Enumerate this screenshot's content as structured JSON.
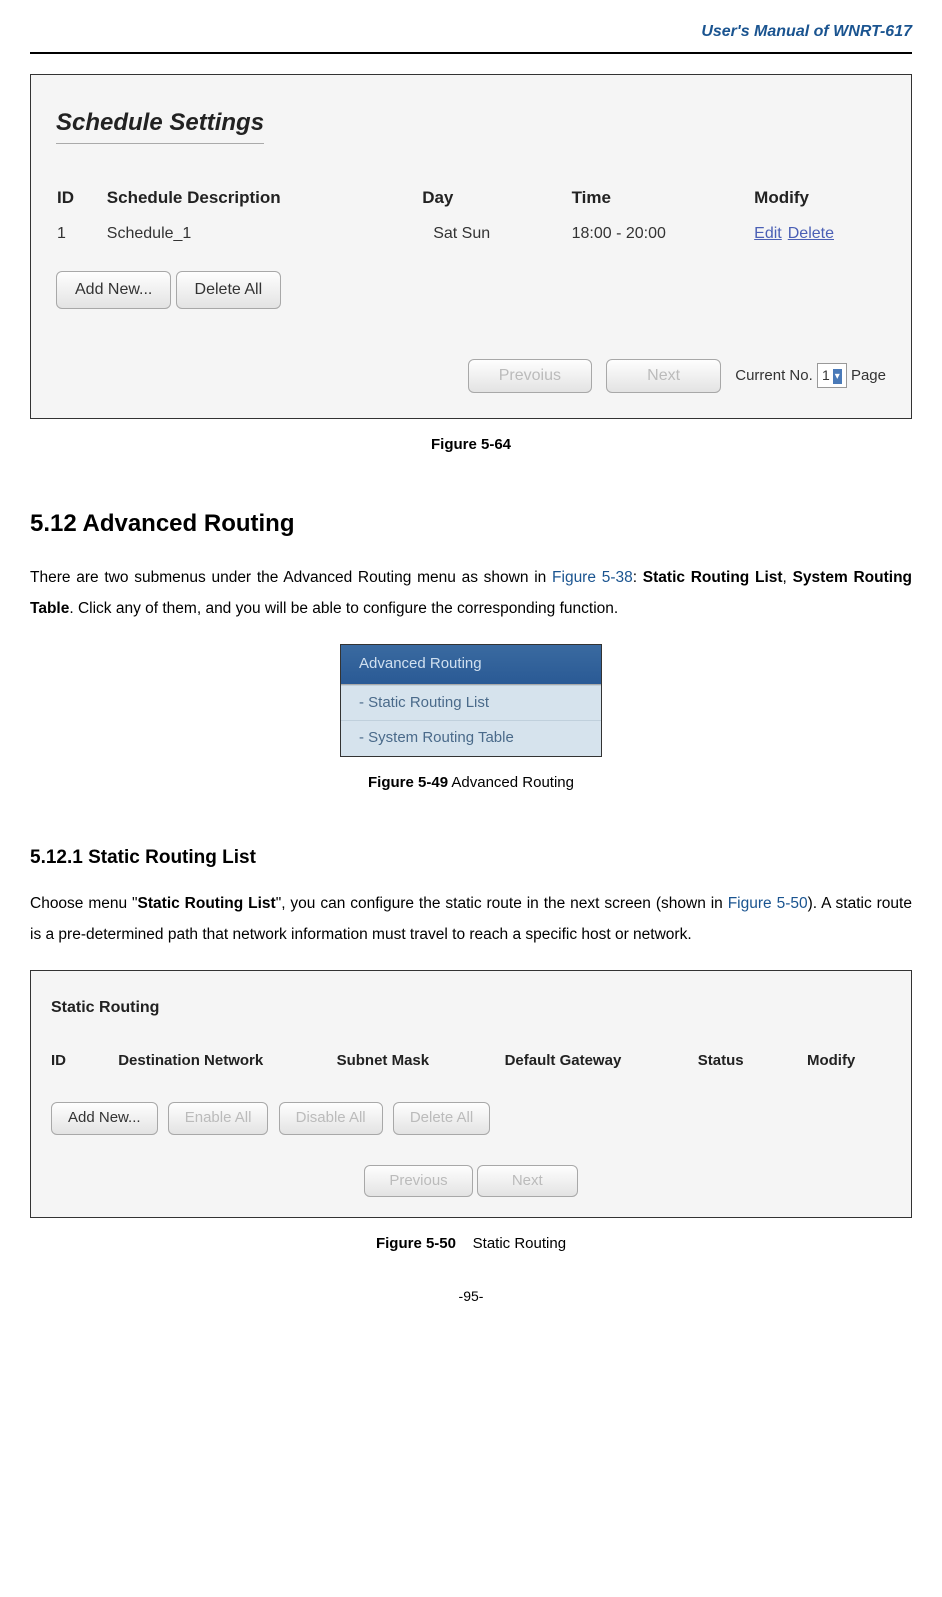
{
  "header": {
    "title": "User's Manual of WNRT-617"
  },
  "schedule": {
    "title": "Schedule Settings",
    "columns": {
      "id": "ID",
      "desc": "Schedule Description",
      "day": "Day",
      "time": "Time",
      "modify": "Modify"
    },
    "row": {
      "id": "1",
      "desc": "Schedule_1",
      "day": "Sat  Sun",
      "time": "18:00 - 20:00",
      "edit": "Edit",
      "delete": "Delete"
    },
    "buttons": {
      "add": "Add New...",
      "delete_all": "Delete All"
    },
    "pager": {
      "prev": "Prevoius",
      "next": "Next",
      "current_label": "Current No.",
      "current_value": "1",
      "page_suffix": "Page"
    }
  },
  "caption1": "Figure 5-64",
  "section512": {
    "heading": "5.12  Advanced Routing",
    "para_pre": "There are two submenus under the Advanced Routing menu as shown in ",
    "para_link": "Figure 5-38",
    "para_mid": ": ",
    "para_b1": "Static Routing List",
    "para_sep": ", ",
    "para_b2": "System Routing Table",
    "para_post": ". Click any of them, and you will be able to configure the corresponding function."
  },
  "menu": {
    "header": "Advanced Routing",
    "item1": "-  Static Routing List",
    "item2": "-  System Routing Table"
  },
  "caption2": {
    "bold": "Figure 5-49",
    "rest": " Advanced Routing"
  },
  "section5121": {
    "heading": "5.12.1  Static Routing List",
    "p1": "Choose menu \"",
    "p1b": "Static Routing List",
    "p2": "\", you can configure the static route in the next screen (shown in ",
    "p2link": "Figure 5-50",
    "p3": "). A static route is a pre-determined path that network information must travel to reach a specific host or network."
  },
  "static_routing": {
    "title": "Static Routing",
    "columns": {
      "id": "ID",
      "dest": "Destination Network",
      "mask": "Subnet Mask",
      "gateway": "Default Gateway",
      "status": "Status",
      "modify": "Modify"
    },
    "buttons": {
      "add": "Add New...",
      "enable_all": "Enable All",
      "disable_all": "Disable All",
      "delete_all": "Delete All",
      "prev": "Previous",
      "next": "Next"
    }
  },
  "caption3": {
    "bold": "Figure 5-50",
    "rest": "    Static Routing"
  },
  "page_number": "-95-"
}
